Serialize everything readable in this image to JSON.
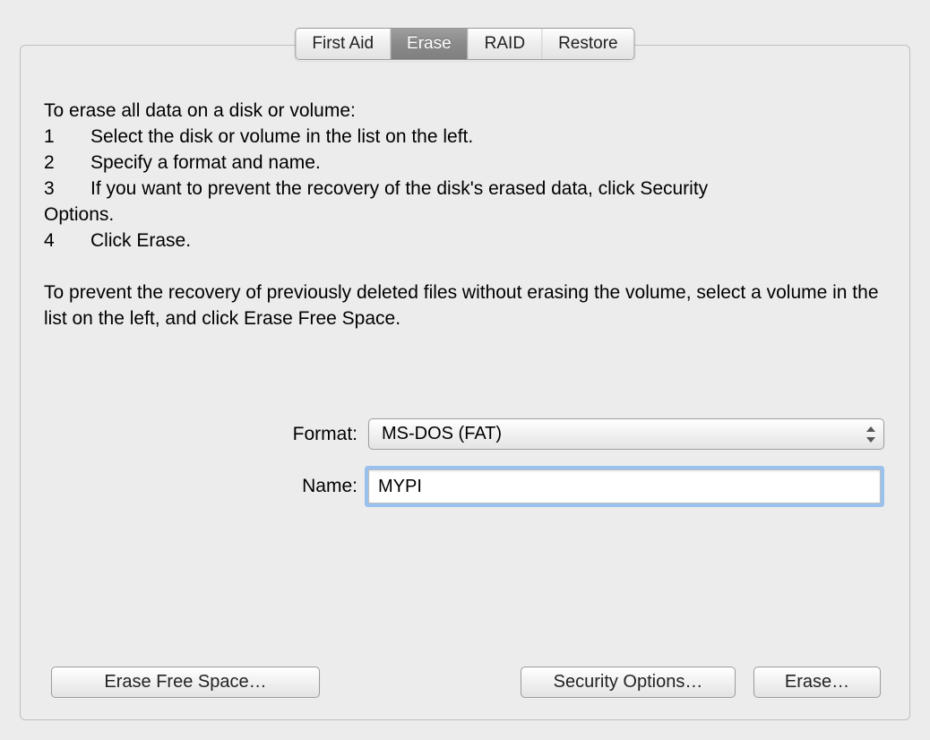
{
  "tabs": {
    "first_aid": "First Aid",
    "erase": "Erase",
    "raid": "RAID",
    "restore": "Restore",
    "active": "erase"
  },
  "instructions": {
    "heading": "To erase all data on a disk or volume:",
    "steps": [
      "Select the disk or volume in the list on the left.",
      "Specify a format and name.",
      "If you want to prevent the recovery of the disk's erased data, click Security Options.",
      "Click Erase."
    ],
    "footer": "To prevent the recovery of previously deleted files without erasing the volume, select a volume in the list on the left, and click Erase Free Space."
  },
  "form": {
    "format_label": "Format:",
    "format_value": "MS-DOS (FAT)",
    "name_label": "Name:",
    "name_value": "MYPI"
  },
  "buttons": {
    "erase_free_space": "Erase Free Space…",
    "security_options": "Security Options…",
    "erase": "Erase…"
  }
}
